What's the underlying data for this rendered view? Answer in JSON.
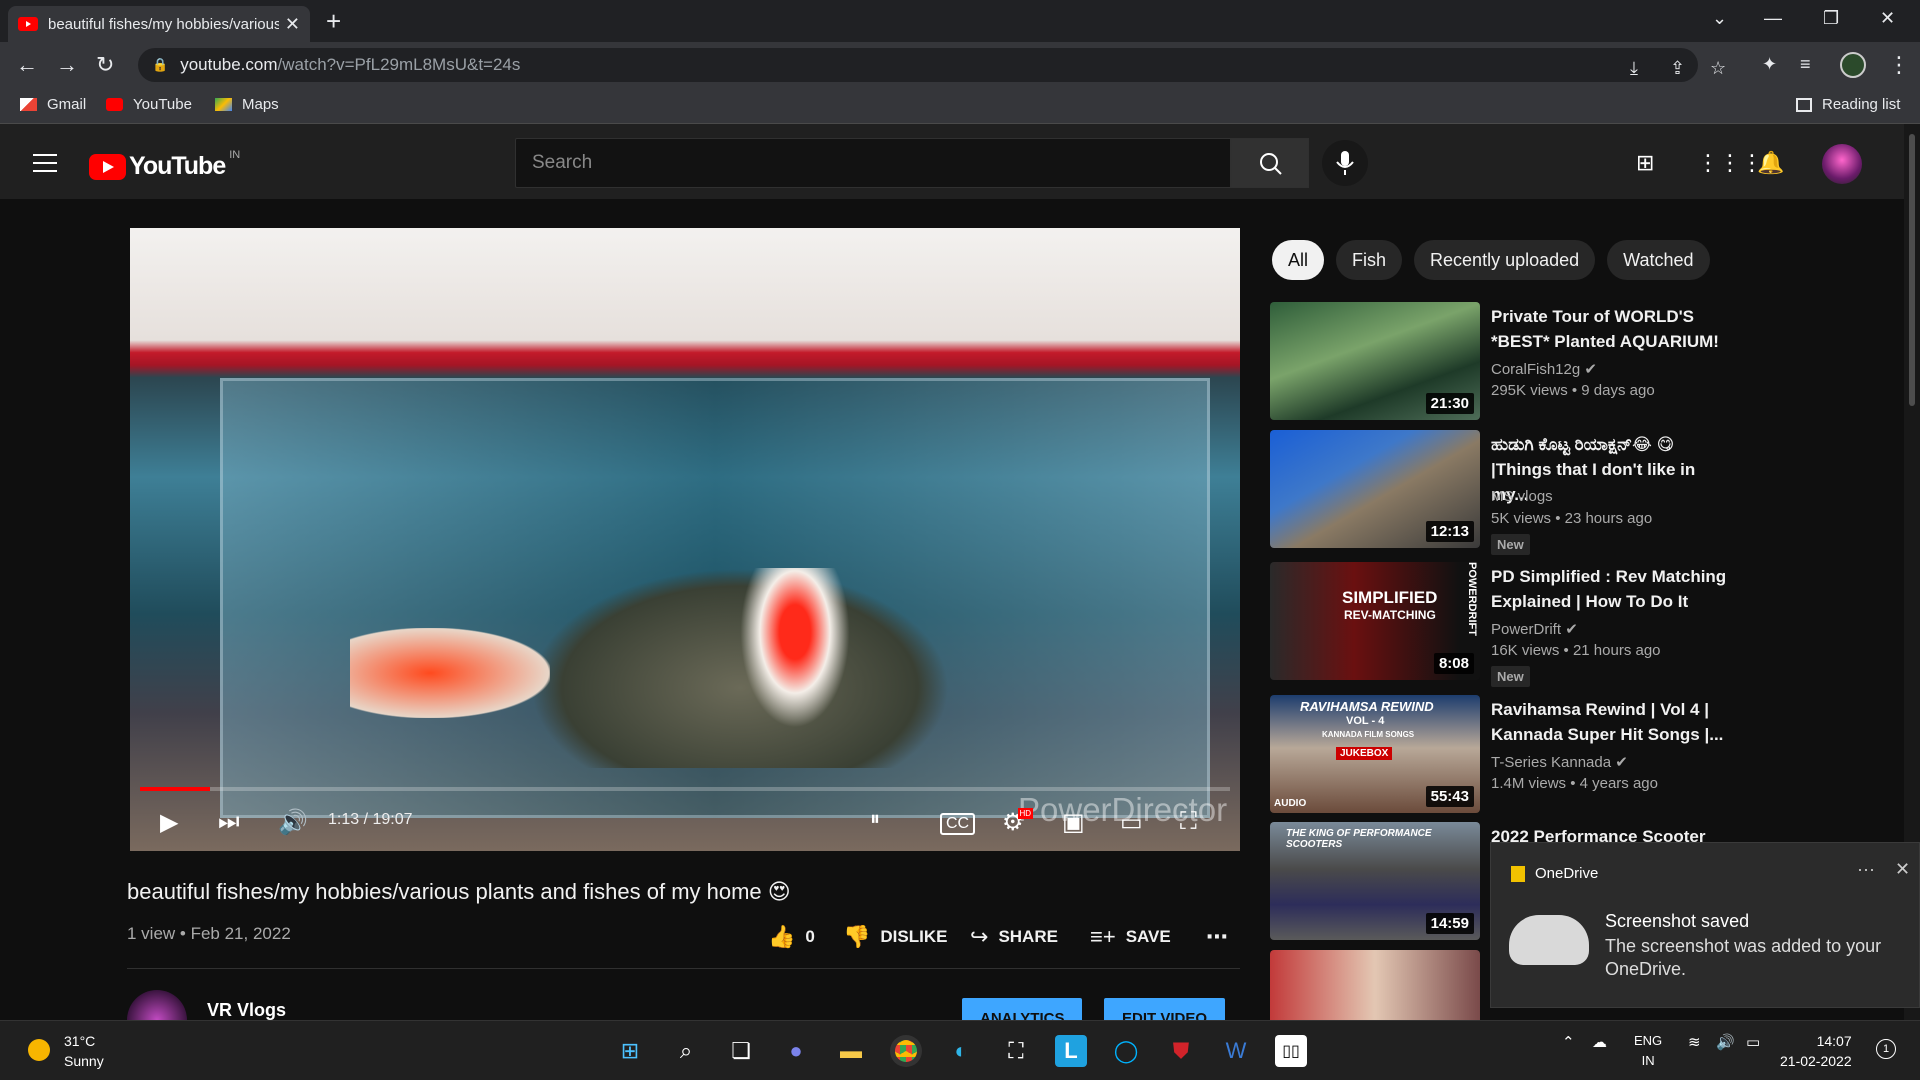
{
  "browser": {
    "tab_title": "beautiful fishes/my hobbies/various",
    "tab_close": "✕",
    "new_tab": "+",
    "url_host": "youtube.com",
    "url_path": "/watch?v=PfL29mL8MsU&t=24s",
    "bookmarks": [
      "Gmail",
      "YouTube",
      "Maps"
    ],
    "reading_list": "Reading list"
  },
  "youtube": {
    "logo_text": "YouTube",
    "country_code": "IN",
    "search_placeholder": "Search"
  },
  "player": {
    "watermark": "PowerDirector",
    "current_time": "1:13 / 19:07",
    "progress_fraction": 0.064,
    "hd_badge": "HD"
  },
  "video": {
    "title": "beautiful fishes/my hobbies/various plants and fishes of my home 😍",
    "meta": "1 view • Feb 21, 2022",
    "likes": "0",
    "dislike_label": "DISLIKE",
    "share_label": "SHARE",
    "save_label": "SAVE",
    "more": "⋯",
    "channel": "VR Vlogs",
    "analytics_label": "ANALYTICS",
    "edit_label": "EDIT VIDEO"
  },
  "chips": [
    "All",
    "Fish",
    "Recently uploaded",
    "Watched"
  ],
  "recommendations": [
    {
      "title": "Private Tour of WORLD'S *BEST* Planted AQUARIUM!",
      "channel": "CoralFish12g",
      "verified": true,
      "views": "295K views • 9 days ago",
      "duration": "21:30",
      "badge": ""
    },
    {
      "title": "ಹುಡುಗಿ ಕೊಟ್ಟ ರಿಯಾಕ್ಷನ್😂 😋 |Things that I don't like in my...",
      "channel": "MS vlogs",
      "verified": false,
      "views": "5K views • 23 hours ago",
      "duration": "12:13",
      "badge": "New"
    },
    {
      "title": "PD Simplified : Rev Matching Explained | How To Do It",
      "channel": "PowerDrift",
      "verified": true,
      "views": "16K views • 21 hours ago",
      "duration": "8:08",
      "badge": "New"
    },
    {
      "title": "Ravihamsa Rewind | Vol 4 | Kannada Super Hit Songs |...",
      "channel": "T-Series Kannada",
      "verified": true,
      "views": "1.4M views • 4 years ago",
      "duration": "55:43",
      "badge": ""
    },
    {
      "title": "2022 Performance Scooter",
      "channel": "",
      "verified": false,
      "views": "",
      "duration": "14:59",
      "badge": ""
    }
  ],
  "thumb_text": {
    "t3_line1": "SIMPLIFIED",
    "t3_line2": "REV-MATCHING",
    "t3_side": "POWERDRIFT",
    "t4_line1": "RAVIHAMSA REWIND",
    "t4_line2": "VOL - 4",
    "t4_line3": "KANNADA FILM SONGS",
    "t4_jukebox": "JUKEBOX",
    "t4_audio": "AUDIO",
    "t5_line1": "THE KING OF PERFORMANCE SCOOTERS"
  },
  "toast": {
    "app": "OneDrive",
    "heading": "Screenshot saved",
    "body": "The screenshot was added to your OneDrive.",
    "menu": "···",
    "close": "✕"
  },
  "taskbar": {
    "temp": "31°C",
    "condition": "Sunny",
    "lang": "ENG",
    "region": "IN",
    "time": "14:07",
    "date": "21-02-2022",
    "notif_count": "1"
  },
  "colors": {
    "accent_red": "#ff0000",
    "button_blue": "#3ea6ff"
  }
}
